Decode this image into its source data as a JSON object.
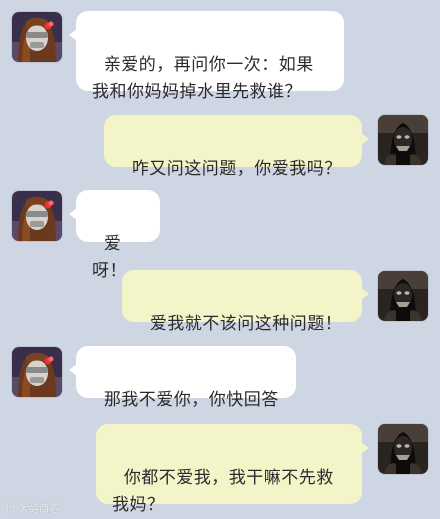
{
  "colors": {
    "background": "#ced6e4",
    "left_bubble": "#ffffff",
    "right_bubble": "#f3f5c9",
    "text": "#2b2b2b"
  },
  "messages": [
    {
      "side": "left",
      "avatar": "girl-avatar-icon",
      "text": "亲爱的，再问你一次：如果\n我和你妈妈掉水里先救谁？"
    },
    {
      "side": "right",
      "avatar": "masked-man-avatar-icon",
      "text": "咋又问这问题，你爱我吗？"
    },
    {
      "side": "left",
      "avatar": "girl-avatar-icon",
      "text": "爱呀！"
    },
    {
      "side": "right",
      "avatar": "masked-man-avatar-icon",
      "text": "爱我就不该问这种问题！"
    },
    {
      "side": "left",
      "avatar": "girl-avatar-icon",
      "text": "那我不爱你，你快回答"
    },
    {
      "side": "right",
      "avatar": "masked-man-avatar-icon",
      "text": "你都不爱我，我干嘛不先救\n我妈？"
    }
  ],
  "watermark": "微 大話西遊"
}
